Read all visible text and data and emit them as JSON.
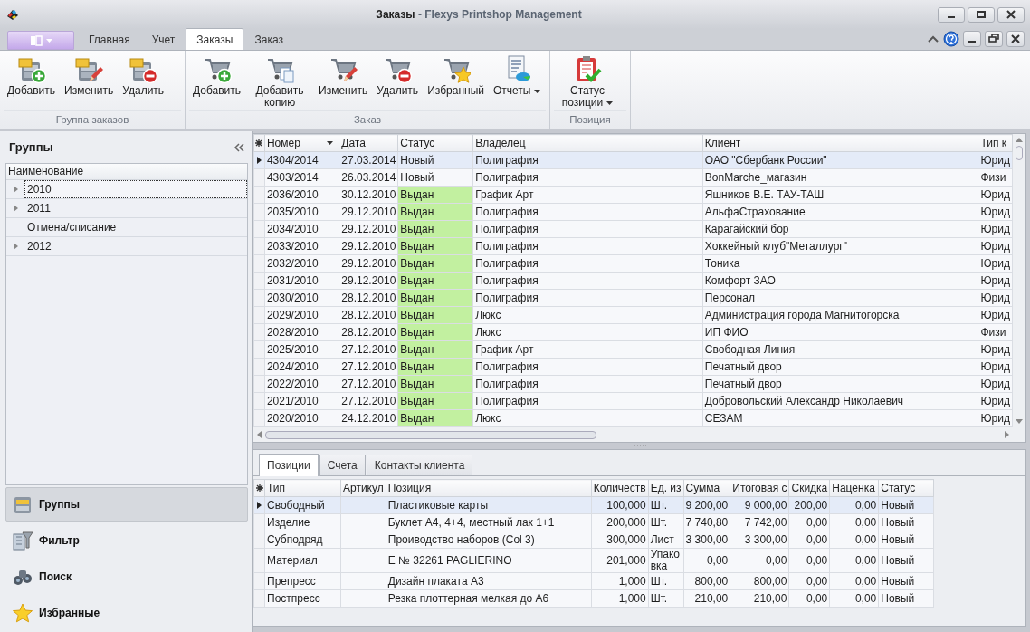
{
  "window": {
    "title": "**Заказы** - Flexys Printshop Management"
  },
  "ribbon": {
    "tabs": [
      {
        "label": "Главная",
        "selected": false
      },
      {
        "label": "Учет",
        "selected": false
      },
      {
        "label": "Заказы",
        "selected": true
      },
      {
        "label": "Заказ",
        "selected": false
      }
    ],
    "groups": [
      {
        "label": "Группа заказов",
        "buttons": [
          {
            "label": "Добавить",
            "dropdown": false
          },
          {
            "label": "Изменить",
            "dropdown": false
          },
          {
            "label": "Удалить",
            "dropdown": false
          }
        ]
      },
      {
        "label": "Заказ",
        "buttons": [
          {
            "label": "Добавить",
            "dropdown": false
          },
          {
            "label": "Добавить копию",
            "dropdown": false
          },
          {
            "label": "Изменить",
            "dropdown": false
          },
          {
            "label": "Удалить",
            "dropdown": false
          },
          {
            "label": "Избранный",
            "dropdown": false
          },
          {
            "label": "Отчеты",
            "dropdown": true
          }
        ]
      },
      {
        "label": "Позиция",
        "buttons": [
          {
            "label": "Статус позиции",
            "dropdown": true
          }
        ]
      }
    ]
  },
  "groups_panel": {
    "title": "Группы",
    "column": "Наименование",
    "items": [
      {
        "label": "2010",
        "expandable": true,
        "selected": true
      },
      {
        "label": "2011",
        "expandable": true,
        "selected": false
      },
      {
        "label": "Отмена/списание",
        "expandable": false,
        "selected": false
      },
      {
        "label": "2012",
        "expandable": true,
        "selected": false
      }
    ]
  },
  "navigation": [
    {
      "label": "Группы",
      "selected": true
    },
    {
      "label": "Фильтр",
      "selected": false
    },
    {
      "label": "Поиск",
      "selected": false
    },
    {
      "label": "Избранные",
      "selected": false
    }
  ],
  "orders": {
    "columns": [
      "Номер",
      "Дата",
      "Статус",
      "Владелец",
      "Клиент",
      "Тип к"
    ],
    "rows": [
      {
        "cells": [
          "4304/2014",
          "27.03.2014",
          "Новый",
          "Полиграфия",
          "ОАО \"Сбербанк России\"",
          "Юрид"
        ],
        "selected": true
      },
      {
        "cells": [
          "4303/2014",
          "26.03.2014",
          "Новый",
          "Полиграфия",
          "BonMarche_магазин",
          "Физи"
        ],
        "selected": false
      },
      {
        "cells": [
          "2036/2010",
          "30.12.2010",
          "Выдан",
          "График Арт",
          "Яшников В.Е. ТАУ-ТАШ",
          "Юрид"
        ],
        "selected": false,
        "color": "#c2f0a0"
      },
      {
        "cells": [
          "2035/2010",
          "29.12.2010",
          "Выдан",
          "Полиграфия",
          "АльфаСтрахование",
          "Юрид"
        ],
        "selected": false,
        "color": "#c2f0a0"
      },
      {
        "cells": [
          "2034/2010",
          "29.12.2010",
          "Выдан",
          "Полиграфия",
          "Карагайский бор",
          "Юрид"
        ],
        "selected": false,
        "color": "#c2f0a0"
      },
      {
        "cells": [
          "2033/2010",
          "29.12.2010",
          "Выдан",
          "Полиграфия",
          "Хоккейный клуб\"Металлург\"",
          "Юрид"
        ],
        "selected": false,
        "color": "#c2f0a0"
      },
      {
        "cells": [
          "2032/2010",
          "29.12.2010",
          "Выдан",
          "Полиграфия",
          "Тоника",
          "Юрид"
        ],
        "selected": false,
        "color": "#c2f0a0"
      },
      {
        "cells": [
          "2031/2010",
          "29.12.2010",
          "Выдан",
          "Полиграфия",
          "Комфорт ЗАО",
          "Юрид"
        ],
        "selected": false,
        "color": "#c2f0a0"
      },
      {
        "cells": [
          "2030/2010",
          "28.12.2010",
          "Выдан",
          "Полиграфия",
          "Персонал",
          "Юрид"
        ],
        "selected": false,
        "color": "#c2f0a0"
      },
      {
        "cells": [
          "2029/2010",
          "28.12.2010",
          "Выдан",
          "Люкс",
          "Администрация города Магнитогорска",
          "Юрид"
        ],
        "selected": false,
        "color": "#c2f0a0"
      },
      {
        "cells": [
          "2028/2010",
          "28.12.2010",
          "Выдан",
          "Люкс",
          "ИП ФИО",
          "Физи"
        ],
        "selected": false,
        "color": "#c2f0a0"
      },
      {
        "cells": [
          "2025/2010",
          "27.12.2010",
          "Выдан",
          "График Арт",
          "Свободная Линия",
          "Юрид"
        ],
        "selected": false,
        "color": "#c2f0a0"
      },
      {
        "cells": [
          "2024/2010",
          "27.12.2010",
          "Выдан",
          "Полиграфия",
          "Печатный двор",
          "Юрид"
        ],
        "selected": false,
        "color": "#c2f0a0"
      },
      {
        "cells": [
          "2022/2010",
          "27.12.2010",
          "Выдан",
          "Полиграфия",
          "Печатный двор",
          "Юрид"
        ],
        "selected": false,
        "color": "#c2f0a0"
      },
      {
        "cells": [
          "2021/2010",
          "27.12.2010",
          "Выдан",
          "Полиграфия",
          "Добровольский Александр Николаевич",
          "Юрид"
        ],
        "selected": false,
        "color": "#c2f0a0"
      },
      {
        "cells": [
          "2020/2010",
          "24.12.2010",
          "Выдан",
          "Люкс",
          "СЕЗАМ",
          "Юрид"
        ],
        "selected": false,
        "color": "#c2f0a0"
      }
    ]
  },
  "positions": {
    "tabs": [
      {
        "label": "Позиции",
        "selected": true
      },
      {
        "label": "Счета",
        "selected": false
      },
      {
        "label": "Контакты клиента",
        "selected": false
      }
    ],
    "columns": [
      "Тип",
      "Артикул",
      "Позиция",
      "Количеств",
      "Ед. из",
      "Сумма",
      "Итоговая с",
      "Скидка",
      "Наценка",
      "Статус"
    ],
    "rows": [
      {
        "cells": [
          "Свободный",
          "",
          "Пластиковые карты",
          "100,000",
          "Шт.",
          "9 200,00",
          "9 000,00",
          "200,00",
          "0,00",
          "Новый"
        ],
        "selected": true
      },
      {
        "cells": [
          "Изделие",
          "",
          "Буклет А4, 4+4, местный лак 1+1",
          "200,000",
          "Шт.",
          "7 740,80",
          "7 742,00",
          "0,00",
          "0,00",
          "Новый"
        ],
        "selected": false
      },
      {
        "cells": [
          "Субподряд",
          "",
          "Проиводство наборов (Col 3)",
          "300,000",
          "Лист",
          "3 300,00",
          "3 300,00",
          "0,00",
          "0,00",
          "Новый"
        ],
        "selected": false
      },
      {
        "cells": [
          "Материал",
          "",
          "Е № 32261 PAGLIERINO",
          "201,000",
          "Упаковка",
          "0,00",
          "0,00",
          "0,00",
          "0,00",
          "Новый"
        ],
        "selected": false
      },
      {
        "cells": [
          "Препресс",
          "",
          "Дизайн плаката А3",
          "1,000",
          "Шт.",
          "800,00",
          "800,00",
          "0,00",
          "0,00",
          "Новый"
        ],
        "selected": false
      },
      {
        "cells": [
          "Постпресс",
          "",
          "Резка плоттерная мелкая до А6",
          "1,000",
          "Шт.",
          "210,00",
          "210,00",
          "0,00",
          "0,00",
          "Новый"
        ],
        "selected": false
      }
    ]
  }
}
